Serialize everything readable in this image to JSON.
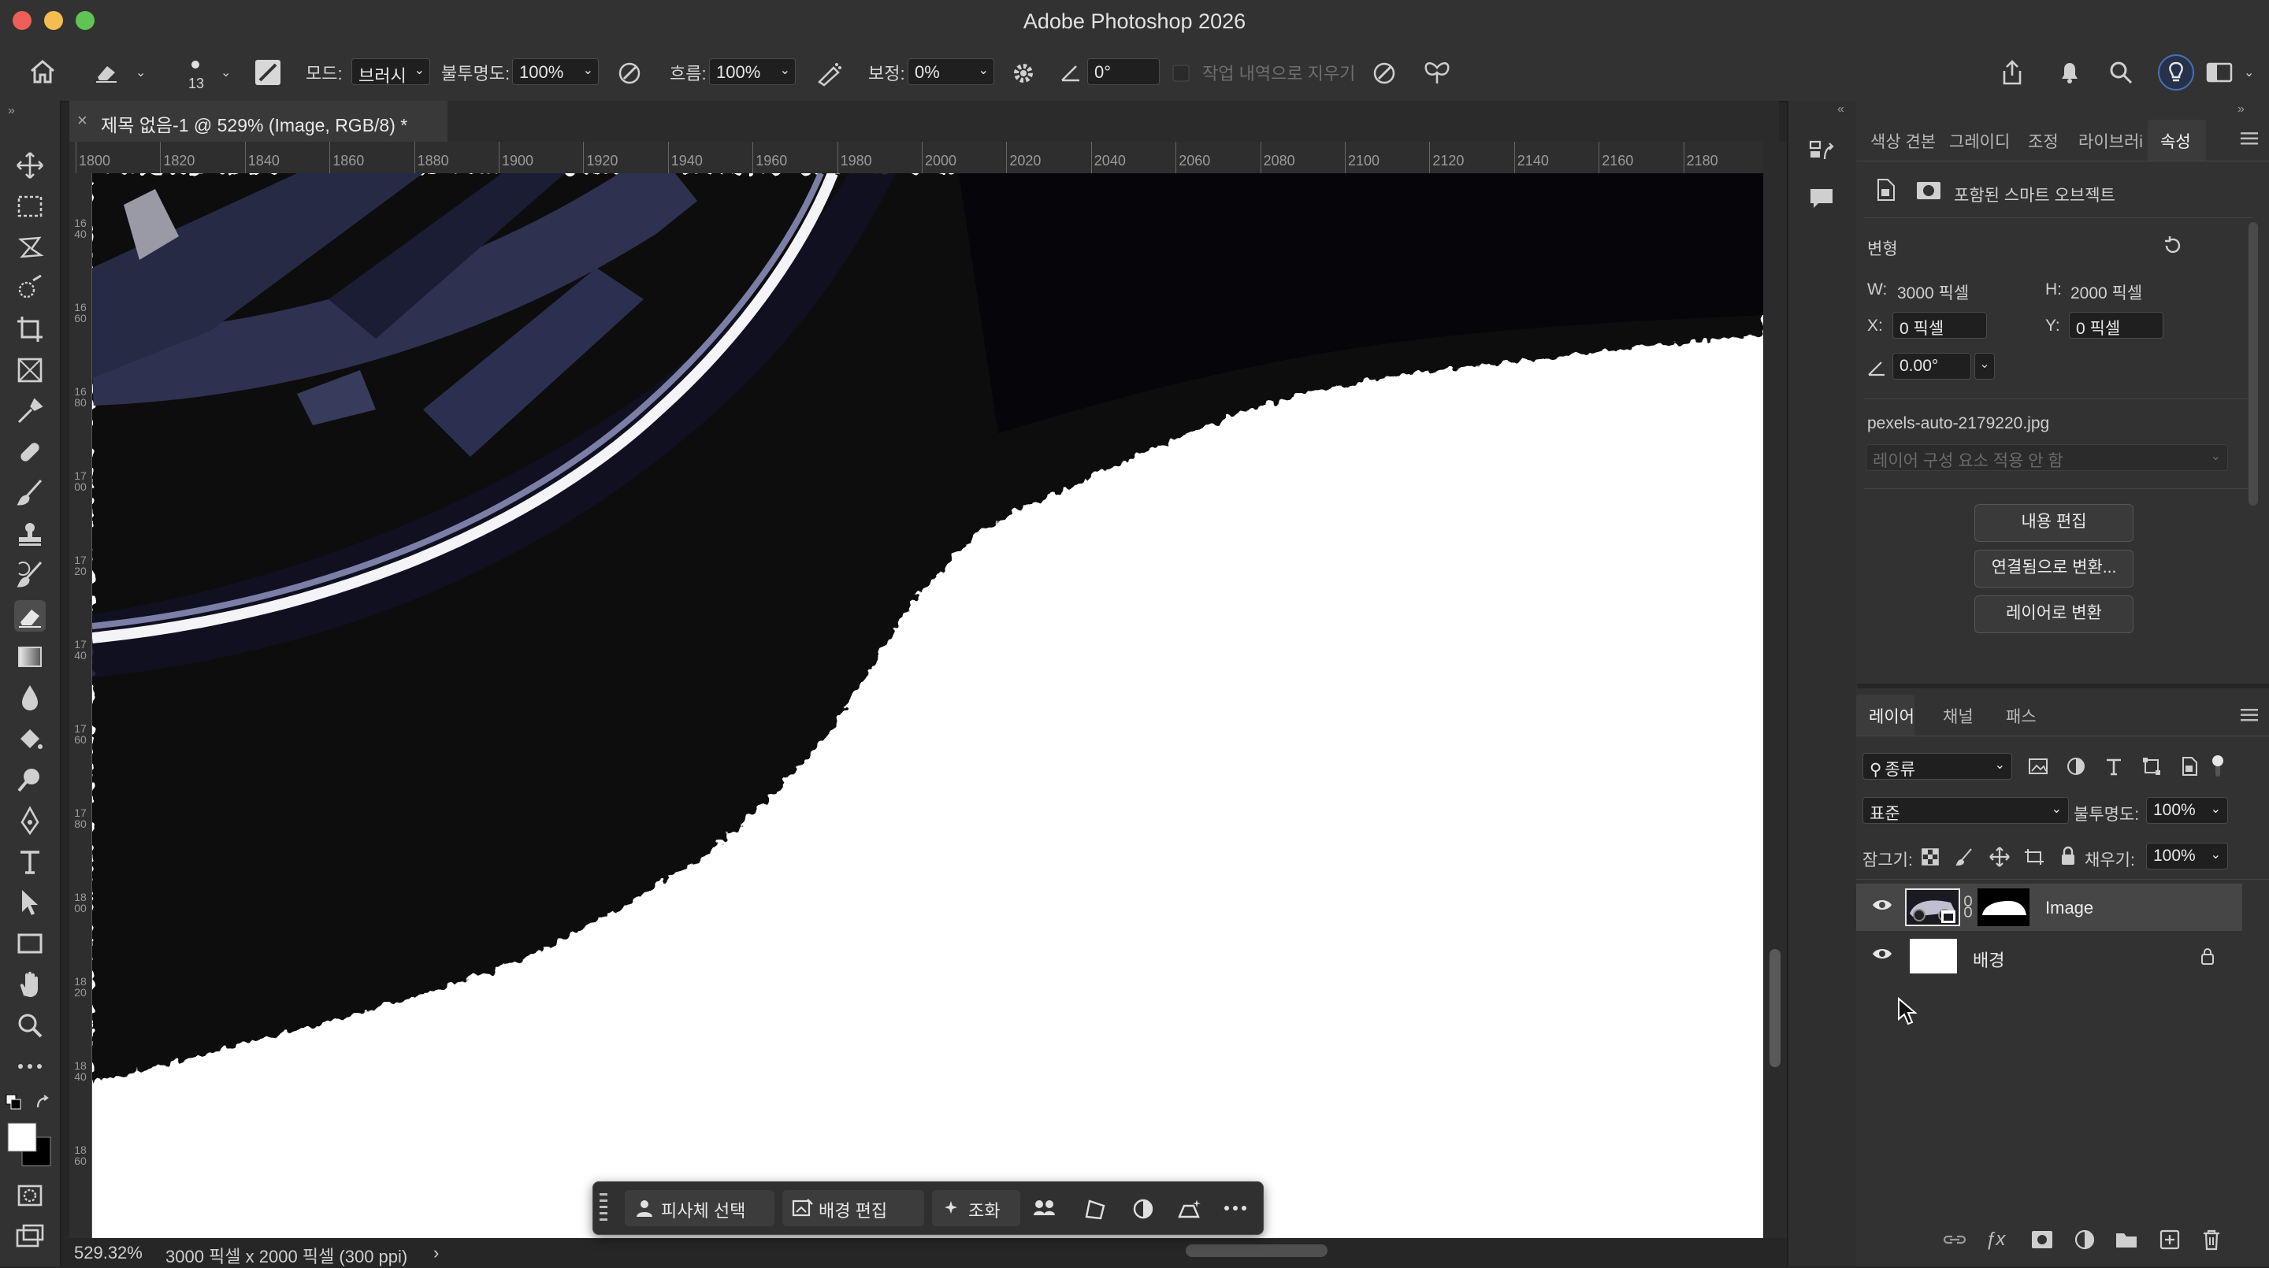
{
  "app": {
    "title": "Adobe Photoshop 2026"
  },
  "options_bar": {
    "brush_size": "13",
    "mode_label": "모드:",
    "mode_value": "브러시",
    "opacity_label": "불투명도:",
    "opacity_value": "100%",
    "flow_label": "흐름:",
    "flow_value": "100%",
    "smoothing_label": "보정:",
    "smoothing_value": "0%",
    "angle_value": "0°",
    "erase_history_label": "작업 내역으로 지우기"
  },
  "document": {
    "tab_title": "제목 없음-1 @ 529% (Image, RGB/8) *",
    "close_glyph": "×"
  },
  "ruler": {
    "h_ticks": [
      "1800",
      "1820",
      "1840",
      "1860",
      "1880",
      "1900",
      "1920",
      "1940",
      "1960",
      "1980",
      "2000",
      "2020",
      "2040",
      "2060",
      "2080",
      "2100",
      "2120",
      "2140",
      "2160",
      "2180"
    ],
    "v_ticks": [
      "1640",
      "1660",
      "1680",
      "1700",
      "1720",
      "1740",
      "1760",
      "1780",
      "1800",
      "1820",
      "1840",
      "1860"
    ]
  },
  "taskbar": {
    "select_subject": "피사체 선택",
    "edit_background": "배경 편집",
    "harmonize": "조화"
  },
  "status": {
    "zoom": "529.32%",
    "doc_info": "3000 픽셀 x 2000 픽셀 (300 ppi)",
    "arrow": "›"
  },
  "properties_panel": {
    "tabs": [
      "색상 견본",
      "그레이디",
      "조정",
      "라이브러i",
      "속성"
    ],
    "active_tab": "속성",
    "object_type": "포함된 스마트 오브젝트",
    "transform_label": "변형",
    "w_label": "W:",
    "w_value": "3000 픽셀",
    "h_label": "H:",
    "h_value": "2000 픽셀",
    "x_label": "X:",
    "x_value": "0 픽셀",
    "y_label": "Y:",
    "y_value": "0 픽셀",
    "angle_value": "0.00°",
    "filename": "pexels-auto-2179220.jpg",
    "layer_comp_placeholder": "레이어 구성 요소 적용 안 함",
    "btn_edit_contents": "내용 편집",
    "btn_convert_linked": "연결됨으로 변환...",
    "btn_convert_layers": "레이어로 변환"
  },
  "layers_panel": {
    "tabs": [
      "레이어",
      "채널",
      "패스"
    ],
    "filter_label": "종류",
    "blend_mode": "표준",
    "opacity_label": "불투명도:",
    "opacity_value": "100%",
    "lock_label": "잠그기:",
    "fill_label": "채우기:",
    "fill_value": "100%",
    "layers": [
      {
        "name": "Image",
        "selected": true
      },
      {
        "name": "배경",
        "selected": false,
        "locked": true
      }
    ]
  },
  "colors": {
    "accent": "#3d7bd6",
    "ui_dark": "#323232",
    "canvas_white": "#ffffff",
    "tire_black": "#07070f"
  }
}
